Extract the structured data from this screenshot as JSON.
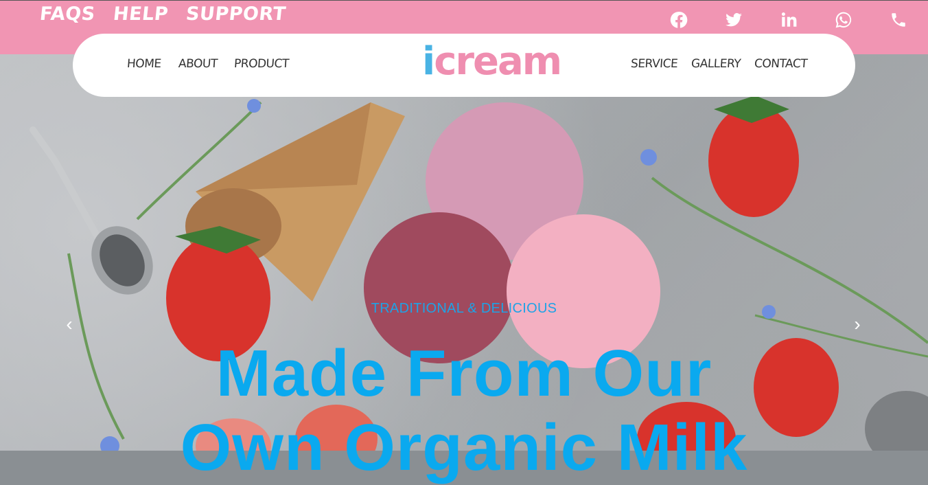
{
  "topbar": {
    "links": [
      "FAQS",
      "HELP",
      "SUPPORT"
    ],
    "social_icons": [
      "facebook-icon",
      "twitter-icon",
      "linkedin-icon",
      "whatsapp-icon",
      "phone-icon"
    ]
  },
  "nav": {
    "left": [
      "HOME",
      "ABOUT",
      "PRODUCT"
    ],
    "right": [
      "SERVICE",
      "GALLERY",
      "CONTACT"
    ]
  },
  "logo": {
    "first": "i",
    "rest": "cream"
  },
  "hero": {
    "subtitle": "TRADITIONAL & DELICIOUS",
    "headline_line1": "Made From Our",
    "headline_line2": "Own Organic Milk",
    "prev_icon": "‹",
    "next_icon": "›"
  },
  "colors": {
    "topbar": "#f195b3",
    "logo_i": "#49b3e4",
    "logo_rest": "#ef8eb0",
    "headline": "#0aa9ef"
  }
}
